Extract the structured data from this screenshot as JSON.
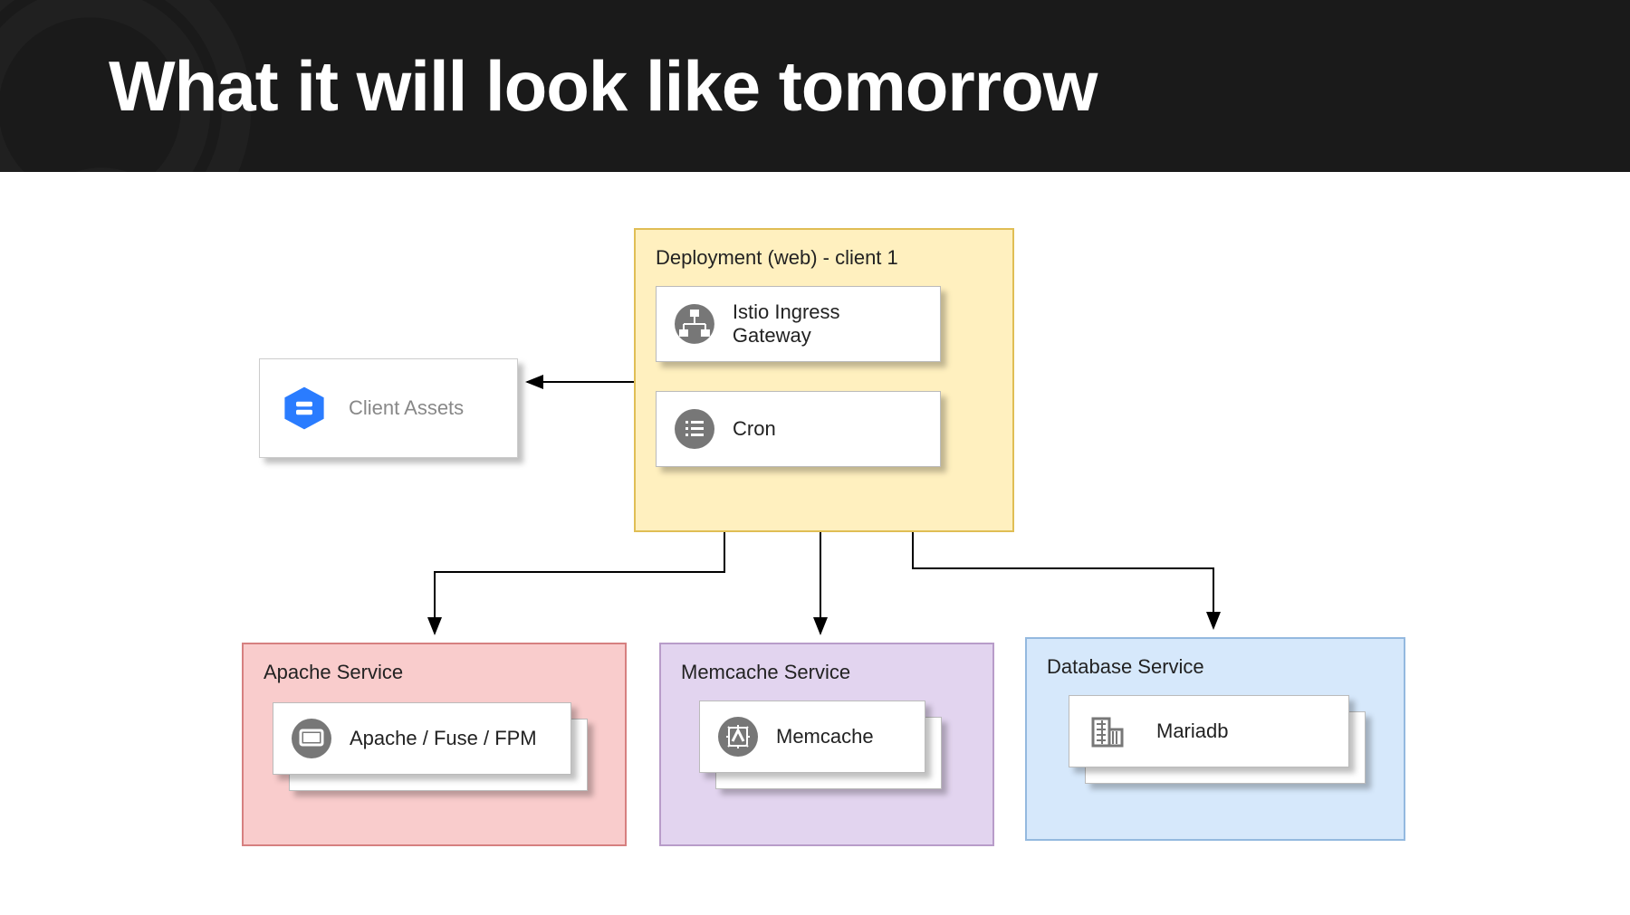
{
  "header": {
    "title": "What it will look like tomorrow"
  },
  "clientAssets": {
    "label": "Client Assets"
  },
  "deployment": {
    "label": "Deployment (web) - client 1",
    "items": [
      {
        "label": "Istio Ingress Gateway",
        "icon": "sitemap-icon"
      },
      {
        "label": "Cron",
        "icon": "list-icon"
      }
    ]
  },
  "services": [
    {
      "label": "Apache Service",
      "card": "Apache / Fuse / FPM",
      "icon": "screen-icon",
      "color": "red"
    },
    {
      "label": "Memcache Service",
      "card": "Memcache",
      "icon": "chip-icon",
      "color": "purple"
    },
    {
      "label": "Database Service",
      "card": "Mariadb",
      "icon": "building-icon",
      "color": "blue"
    }
  ],
  "colors": {
    "yellowFill": "#fff0bf",
    "yellowBorder": "#e0be55",
    "redFill": "#f9cccc",
    "redBorder": "#d68080",
    "purpleFill": "#e2d4ef",
    "purpleBorder": "#b89cc9",
    "blueFill": "#d6e8fb",
    "blueBorder": "#94b9df"
  }
}
